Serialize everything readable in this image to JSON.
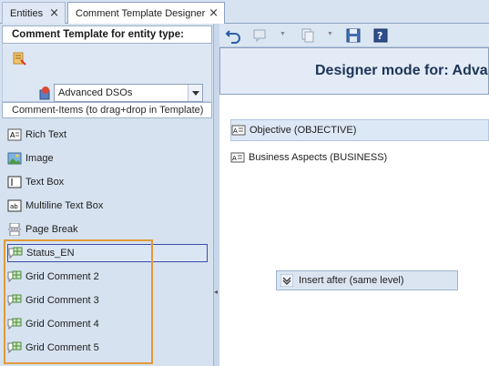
{
  "tabs": [
    {
      "label": "Entities",
      "active": false
    },
    {
      "label": "Comment Template Designer",
      "active": true
    }
  ],
  "left": {
    "header": "Comment Template for entity type:",
    "entity_type": "Advanced DSOs",
    "items_header": "Comment-Items (to drag+drop in Template)",
    "items": [
      {
        "label": "Rich Text",
        "icon": "rich-text-icon"
      },
      {
        "label": "Image",
        "icon": "image-icon"
      },
      {
        "label": "Text Box",
        "icon": "text-box-icon"
      },
      {
        "label": "Multiline Text Box",
        "icon": "multiline-text-box-icon"
      },
      {
        "label": "Page Break",
        "icon": "page-break-icon"
      },
      {
        "label": "Status_EN",
        "icon": "grid-comment-icon",
        "selected": true
      },
      {
        "label": "Grid Comment 2",
        "icon": "grid-comment-icon"
      },
      {
        "label": "Grid Comment 3",
        "icon": "grid-comment-icon"
      },
      {
        "label": "Grid Comment 4",
        "icon": "grid-comment-icon"
      },
      {
        "label": "Grid Comment 5",
        "icon": "grid-comment-icon"
      }
    ]
  },
  "toolbar": {
    "icons": [
      "undo-icon",
      "comment-icon",
      "copy-icon",
      "save-icon",
      "help-icon"
    ]
  },
  "designer": {
    "header": "Designer mode for: Adva",
    "items": [
      {
        "label": "Objective (OBJECTIVE)",
        "selected": true
      },
      {
        "label": "Business Aspects (BUSINESS)",
        "selected": false
      }
    ],
    "insert_button": "Insert after (same level)"
  },
  "colors": {
    "accent_border": "#e09a39",
    "selection_border": "#3a4fa6",
    "header_text": "#1f3557"
  }
}
